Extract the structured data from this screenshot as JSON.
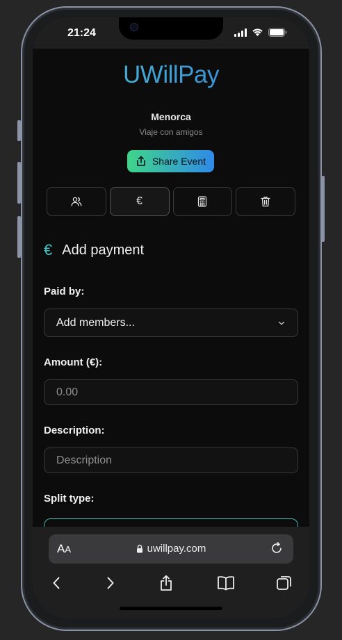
{
  "status": {
    "time": "21:24"
  },
  "app": {
    "logo": "UWillPay"
  },
  "event": {
    "name": "Menorca",
    "description": "Viaje con amigos",
    "share_label": "Share Event"
  },
  "tabs": [
    {
      "icon": "users-icon"
    },
    {
      "icon": "euro-icon",
      "label": "€"
    },
    {
      "icon": "calculator-icon"
    },
    {
      "icon": "trash-icon"
    }
  ],
  "form": {
    "section_icon": "€",
    "title": "Add payment",
    "paid_by_label": "Paid by:",
    "paid_by_value": "Add members...",
    "amount_label": "Amount (€):",
    "amount_placeholder": "0.00",
    "description_label": "Description:",
    "description_placeholder": "Description",
    "split_label": "Split type:"
  },
  "browser": {
    "aa_big": "A",
    "aa_small": "A",
    "url": "uwillpay.com"
  },
  "colors": {
    "accent": "#40c4c4",
    "gradient_start": "#3fd58a",
    "gradient_end": "#2f8ae8"
  }
}
